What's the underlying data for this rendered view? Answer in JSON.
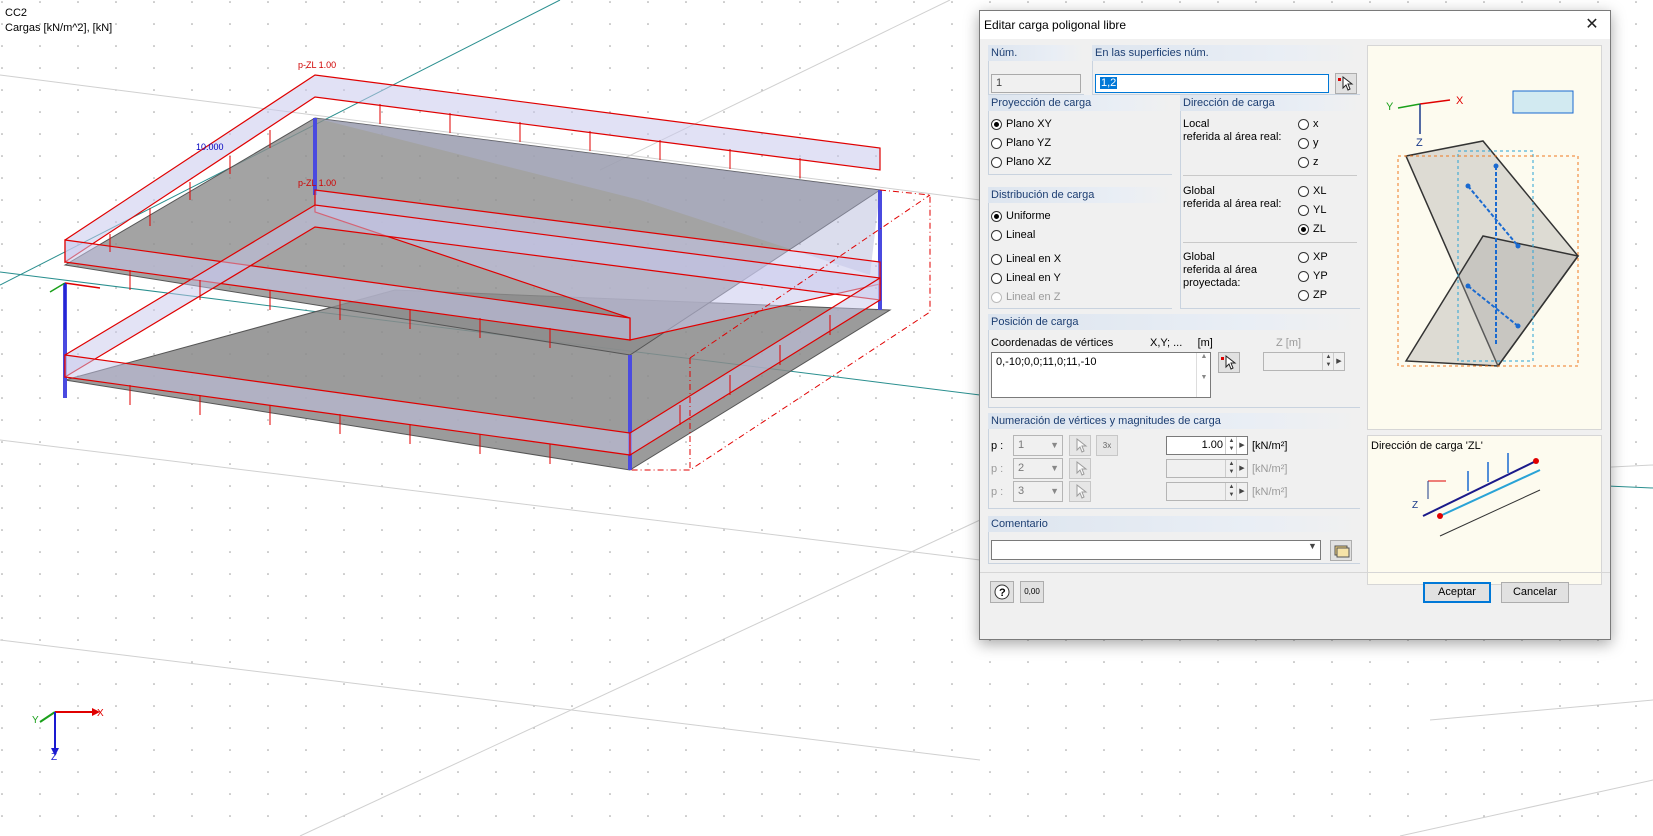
{
  "viewport": {
    "load_case": "CC2",
    "load_units": "Cargas [kN/m^2], [kN]",
    "labels": {
      "load_top": "p-ZL 1.00",
      "load_mid": "p-ZL 1.00",
      "dimension": "10.000"
    },
    "axes": {
      "x": "X",
      "y": "Y",
      "z": "Z"
    },
    "colors": {
      "load": "#e00000",
      "column": "#4a4ae0",
      "slab": "#8c8c8c",
      "grid": "#2a8f8f"
    }
  },
  "dialog": {
    "title": "Editar carga poligonal libre",
    "close_icon": "close-icon",
    "num": {
      "label": "Núm.",
      "value": "1"
    },
    "surfaces": {
      "label": "En las superficies núm.",
      "value": "1,2"
    },
    "projection": {
      "title": "Proyección de carga",
      "options": [
        "Plano XY",
        "Plano YZ",
        "Plano XZ"
      ],
      "selected": "Plano XY"
    },
    "distribution": {
      "title": "Distribución de carga",
      "options": [
        "Uniforme",
        "Lineal",
        "Lineal en X",
        "Lineal en Y",
        "Lineal en Z"
      ],
      "selected": "Uniforme"
    },
    "direction": {
      "title": "Dirección de carga",
      "local_label": "Local\nreferida al área real:",
      "local_options": [
        "x",
        "y",
        "z"
      ],
      "global_real_label": "Global\nreferida al área real:",
      "global_real_options": [
        "XL",
        "YL",
        "ZL"
      ],
      "global_proj_label": "Global\nreferida al área\nproyectada:",
      "global_proj_options": [
        "XP",
        "YP",
        "ZP"
      ],
      "selected": "ZL"
    },
    "position": {
      "title": "Posición de carga",
      "coords_label": "Coordenadas de vértices",
      "coords_units": "X,Y; ...     [m]",
      "coords_value": "0,-10;0,0;11,0;11,-10",
      "z_label": "Z  [m]"
    },
    "magnitudes": {
      "title": "Numeración de vértices y magnitudes de carga",
      "rows": [
        {
          "label": "p :",
          "vertex": "1",
          "value": "1.00",
          "unit": "[kN/m²]"
        },
        {
          "label": "p :",
          "vertex": "2",
          "value": "",
          "unit": "[kN/m²]"
        },
        {
          "label": "p :",
          "vertex": "3",
          "value": "",
          "unit": "[kN/m²]"
        }
      ]
    },
    "comment": {
      "title": "Comentario",
      "value": ""
    },
    "direction_preview": {
      "title": "Dirección de carga 'ZL'"
    },
    "buttons": {
      "accept": "Aceptar",
      "cancel": "Cancelar"
    },
    "icon_labels": {
      "set_3x": "3x",
      "calc": "0,00"
    }
  }
}
